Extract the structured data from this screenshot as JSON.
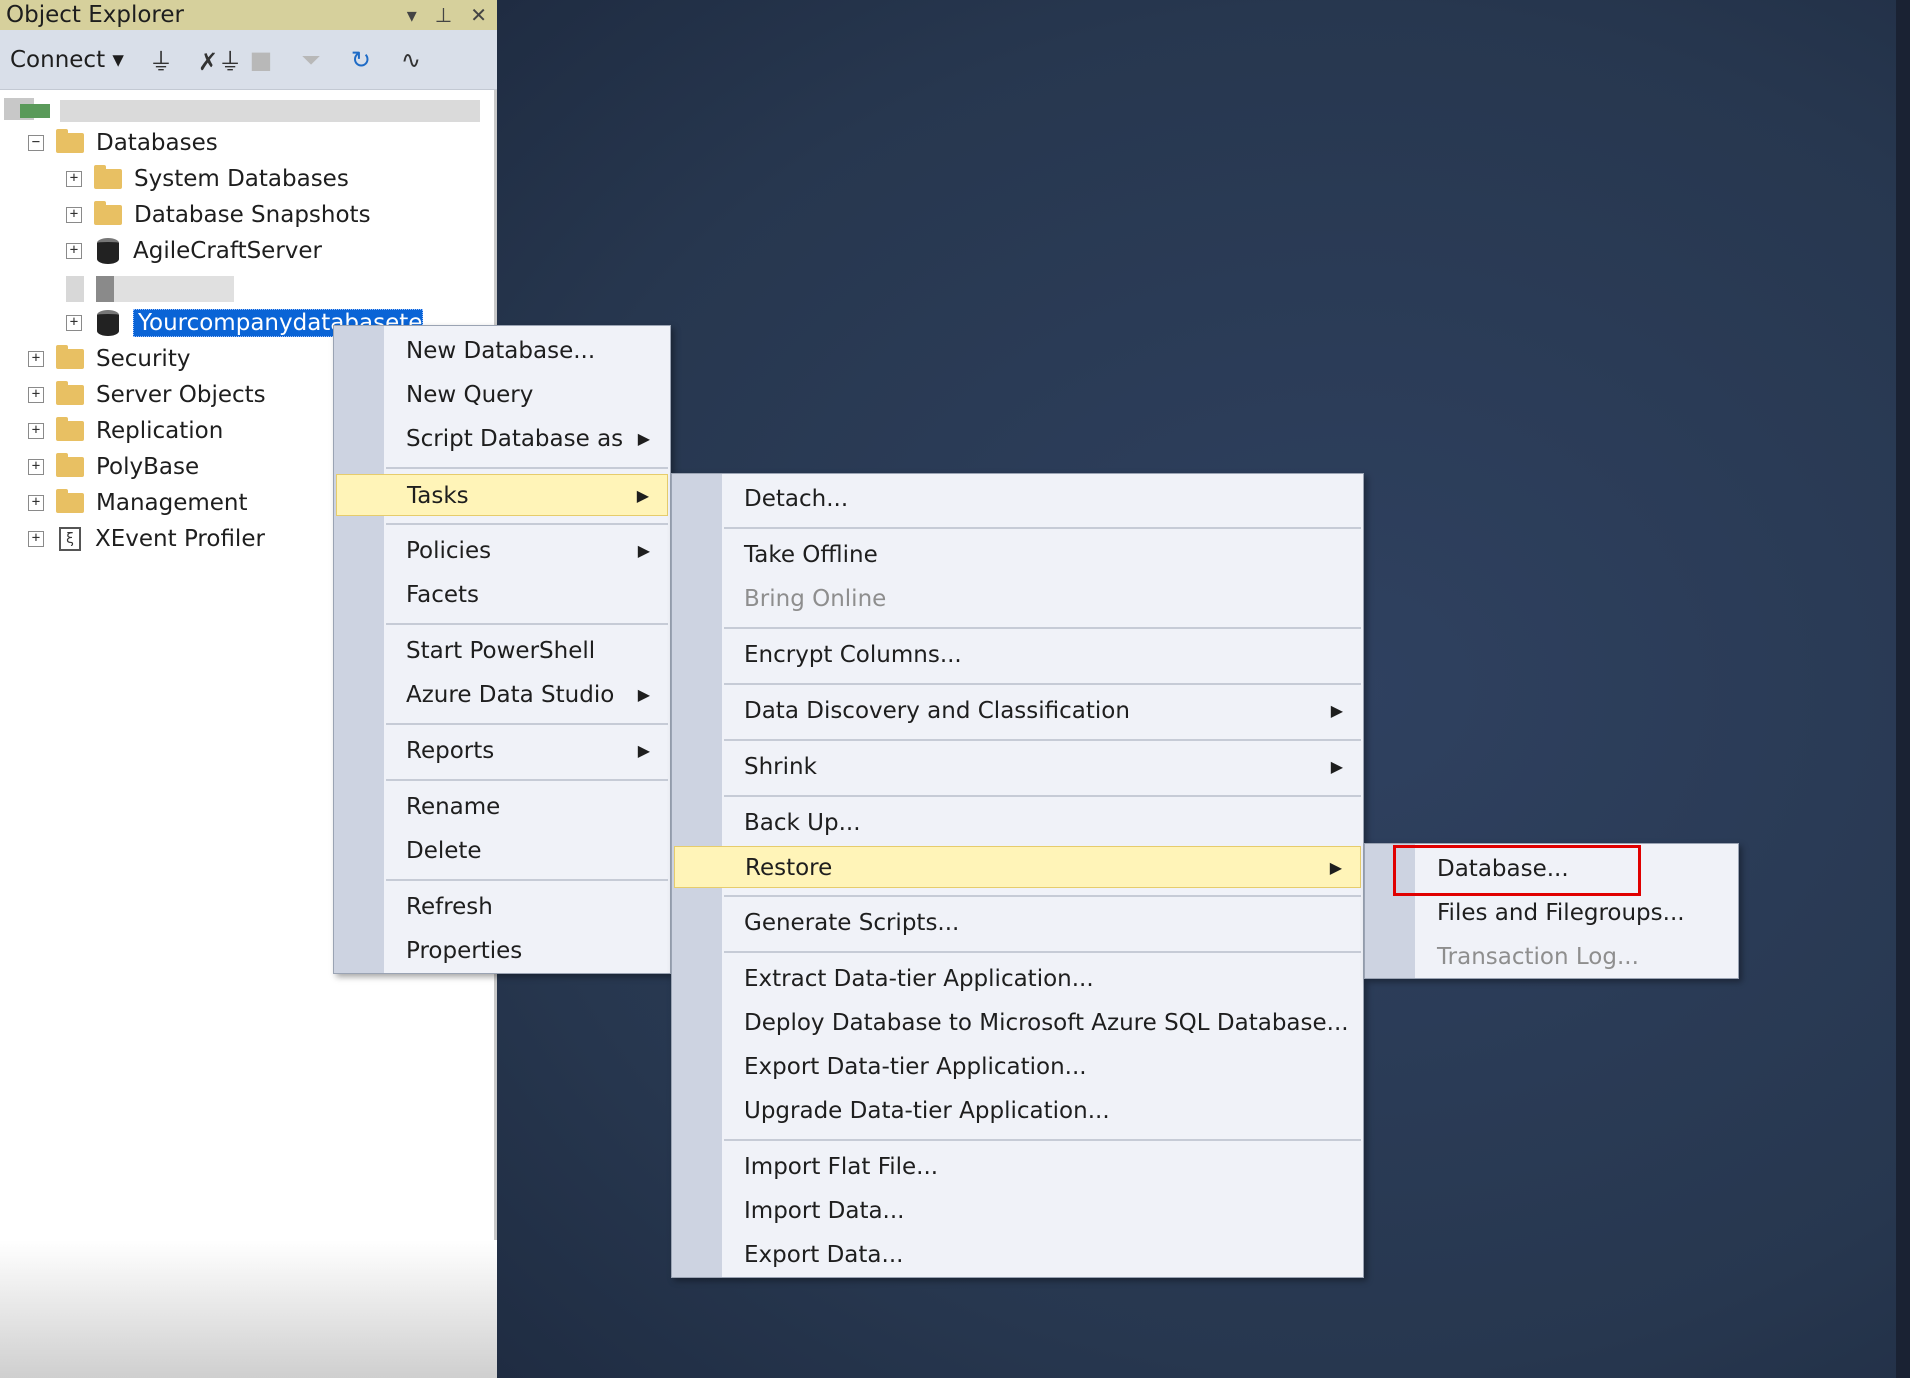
{
  "object_explorer": {
    "title": "Object Explorer",
    "title_icons": [
      "pin-dropdown-icon",
      "pin-icon",
      "close-icon"
    ],
    "connect_label": "Connect",
    "toolbar_icons": [
      "connect-plug-icon",
      "disconnect-plug-icon",
      "stop-icon",
      "filter-icon",
      "refresh-icon",
      "activity-monitor-icon"
    ],
    "tree": {
      "databases": "Databases",
      "system_databases": "System Databases",
      "database_snapshots": "Database Snapshots",
      "agilecraft": "AgileCraftServer",
      "selected_db": "Yourcompanydatabasetest",
      "security": "Security",
      "server_objects": "Server Objects",
      "replication": "Replication",
      "polybase": "PolyBase",
      "management": "Management",
      "xevent": "XEvent Profiler"
    }
  },
  "context_menu": {
    "new_database": "New Database...",
    "new_query": "New Query",
    "script_database_as": "Script Database as",
    "tasks": "Tasks",
    "policies": "Policies",
    "facets": "Facets",
    "start_powershell": "Start PowerShell",
    "azure_data_studio": "Azure Data Studio",
    "reports": "Reports",
    "rename": "Rename",
    "delete": "Delete",
    "refresh": "Refresh",
    "properties": "Properties"
  },
  "tasks_menu": {
    "detach": "Detach...",
    "take_offline": "Take Offline",
    "bring_online": "Bring Online",
    "encrypt_columns": "Encrypt Columns...",
    "data_discovery": "Data Discovery and Classification",
    "shrink": "Shrink",
    "back_up": "Back Up...",
    "restore": "Restore",
    "generate_scripts": "Generate Scripts...",
    "extract_dac": "Extract Data-tier Application...",
    "deploy_azure": "Deploy Database to Microsoft Azure SQL Database...",
    "export_dac": "Export Data-tier Application...",
    "upgrade_dac": "Upgrade Data-tier Application...",
    "import_flat_file": "Import Flat File...",
    "import_data": "Import Data...",
    "export_data": "Export Data..."
  },
  "restore_menu": {
    "database": "Database...",
    "files_filegroups": "Files and Filegroups...",
    "transaction_log": "Transaction Log..."
  },
  "colors": {
    "highlight": "#fff4b8",
    "selection": "#0a64d6",
    "callout": "#e00000",
    "workspace": "#2b3a52"
  }
}
